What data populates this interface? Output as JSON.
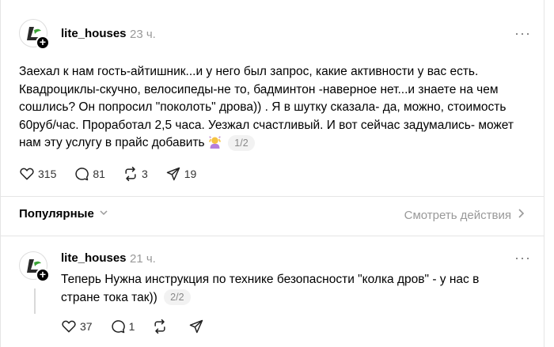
{
  "post1": {
    "username": "lite_houses",
    "time": "23 ч.",
    "more": "···",
    "text": "Заехал к нам гость-айтишник...и у него был запрос, какие активности у вас есть. Квадроциклы-скучно, велосипеды-не то, бадминтон -наверное нет...и знаете на чем сошлись? Он попросил \"поколоть\" дрова)) . Я в шутку сказала- да, можно, стоимость 60руб/час. Проработал 2,5 часа. Уезжал счастливый. И вот сейчас задумались- может нам эту услугу в прайс добавить",
    "pager": "1/2",
    "likes": "315",
    "comments": "81",
    "reposts": "3",
    "shares": "19"
  },
  "sort": {
    "label": "Популярные",
    "activity_label": "Смотреть действия"
  },
  "post2": {
    "username": "lite_houses",
    "time": "21 ч.",
    "more": "···",
    "text": "Теперь Нужна инструкция по технике безопасности \"колка дров\" - у нас в стране тока так))",
    "pager": "2/2",
    "likes": "37",
    "comments": "1"
  },
  "icons": [
    "heart-icon",
    "comment-icon",
    "repost-icon",
    "share-icon",
    "more-icon",
    "plus-icon",
    "chevron-down-icon",
    "chevron-right-icon"
  ],
  "colors": {
    "muted": "#999999",
    "text": "#000000",
    "divider": "#e5e5e5"
  }
}
